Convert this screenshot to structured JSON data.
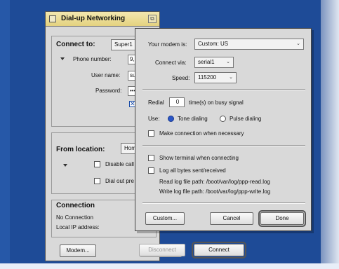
{
  "main_window": {
    "title": "Dial-up Networking",
    "connect_to": {
      "label": "Connect to:",
      "selected": "Super1"
    },
    "phone_label": "Phone number:",
    "phone_value": "9,3",
    "username_label": "User name:",
    "username_value": "sup",
    "password_label": "Password:",
    "password_value": "•••",
    "save_password_checked": true,
    "from_location": {
      "label": "From location:",
      "selected": "Hom",
      "disable_call_waiting": "Disable call",
      "dial_out_prefix": "Dial out pre"
    },
    "connection": {
      "title": "Connection",
      "status": "No Connection",
      "local_ip_label": "Local IP address:"
    },
    "buttons": {
      "modem": "Modem...",
      "disconnect": "Disconnect",
      "connect": "Connect"
    }
  },
  "modem_dialog": {
    "modem_label": "Your modem is:",
    "modem_value": "Custom: US",
    "connect_via_label": "Connect via:",
    "connect_via_value": "serial1",
    "speed_label": "Speed:",
    "speed_value": "115200",
    "redial_label": "Redial",
    "redial_value": "0",
    "redial_suffix": "time(s) on busy signal",
    "use_label": "Use:",
    "tone_dialing": "Tone dialing",
    "pulse_dialing": "Pulse dialing",
    "tone_selected": true,
    "make_connection": "Make connection when necessary",
    "show_terminal": "Show terminal when connecting",
    "log_bytes": "Log all bytes sent/received",
    "read_log_path": "Read log file path: /boot/var/log/ppp-read.log",
    "write_log_path": "Write log file path: /boot/var/log/ppp-write.log",
    "buttons": {
      "custom": "Custom...",
      "cancel": "Cancel",
      "done": "Done"
    }
  },
  "icons": {
    "close": "close-box-icon",
    "zoom": "zoom-box-icon",
    "popup": "chevron-down-icon",
    "disclosure": "disclosure-triangle-icon",
    "checkmark": "x-check-icon"
  },
  "colors": {
    "desktop": "#1e4b97",
    "titlebar": "#e4d27f",
    "radio_selected": "#2a56c6"
  }
}
